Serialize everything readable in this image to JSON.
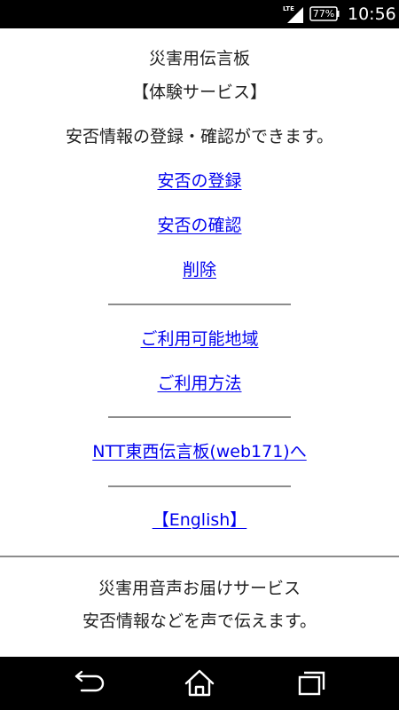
{
  "status_bar": {
    "network": "LTE",
    "battery": "77%",
    "time": "10:56",
    "icons": [
      "signal-icon",
      "battery-icon"
    ]
  },
  "header": {
    "title": "災害用伝言板",
    "subtitle": "【体験サービス】",
    "description": "安否情報の登録・確認ができます。"
  },
  "menu": {
    "register": "安否の登録",
    "confirm": "安否の確認",
    "delete": "削除",
    "available_area": "ご利用可能地域",
    "how_to_use": "ご利用方法",
    "web171": "NTT東西伝言板(web171)へ",
    "english": "【English】"
  },
  "footer_info": {
    "title": "災害用音声お届けサービス",
    "description": "安否情報などを声で伝えます。"
  },
  "nav_bar": {
    "icons": [
      "back-icon",
      "home-icon",
      "recent-apps-icon"
    ]
  },
  "colors": {
    "link": "#0000ee",
    "text": "#222222",
    "divider": "#8c8c8c",
    "bars": "#000000"
  }
}
